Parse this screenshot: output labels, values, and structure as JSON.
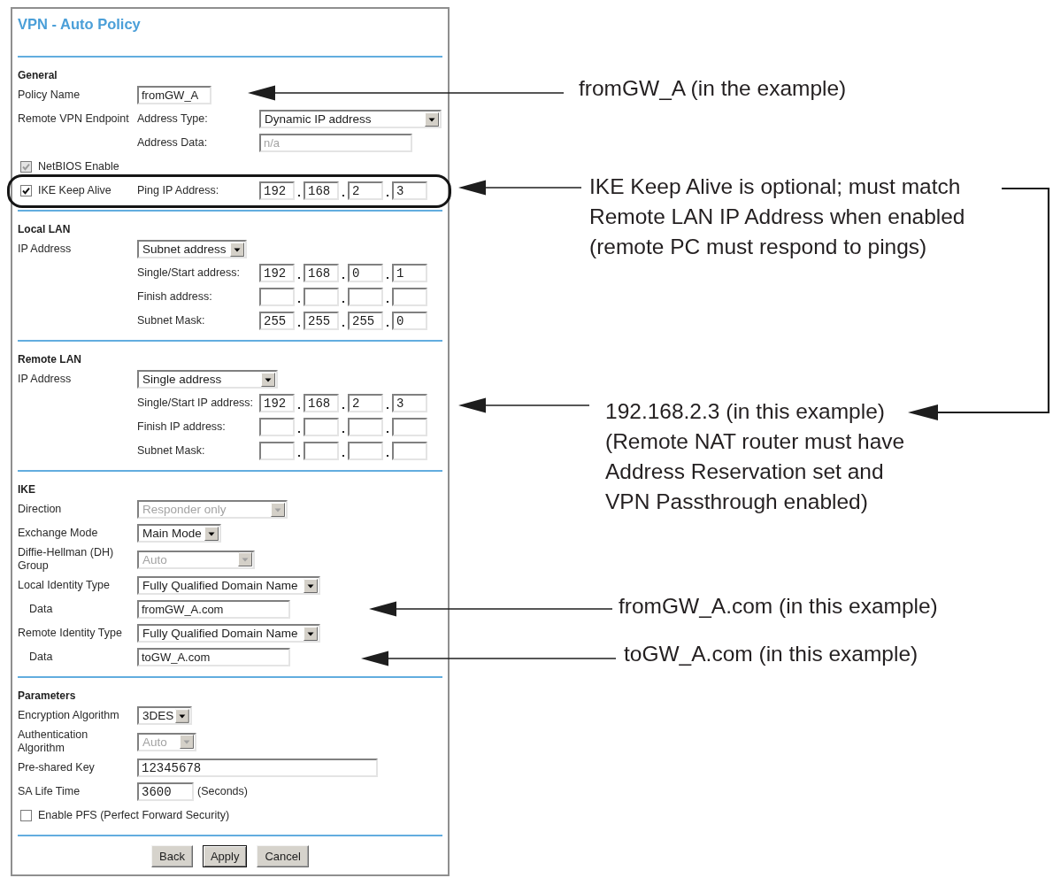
{
  "form": {
    "title": "VPN - Auto Policy",
    "sections": [
      {
        "heading": "General",
        "rows": [
          {
            "kind": "text",
            "label": "Policy Name",
            "value": "fromGW_A",
            "disabled": false
          },
          {
            "kind": "select",
            "label": "Remote VPN Endpoint",
            "sublabel": "Address Type:",
            "value": "Dynamic IP address",
            "disabled": false
          },
          {
            "kind": "text",
            "sublabel": "Address Data:",
            "value": "n/a",
            "disabled": true
          },
          {
            "kind": "check",
            "check": {
              "label": "NetBIOS Enable",
              "checked": true,
              "disabled": true
            }
          },
          {
            "kind": "ip",
            "check": {
              "label": "IKE Keep Alive",
              "checked": true,
              "disabled": false
            },
            "sublabel": "Ping IP Address:",
            "octets": [
              "192",
              "168",
              "2",
              "3"
            ]
          }
        ]
      },
      {
        "heading": "Local LAN",
        "rows": [
          {
            "kind": "select",
            "label": "IP Address",
            "value": "Subnet address",
            "disabled": false
          },
          {
            "kind": "ip",
            "sublabel": "Single/Start address:",
            "octets": [
              "192",
              "168",
              "0",
              "1"
            ]
          },
          {
            "kind": "ip",
            "sublabel": "Finish address:"
          },
          {
            "kind": "ip",
            "sublabel": "Subnet Mask:",
            "octets": [
              "255",
              "255",
              "255",
              "0"
            ]
          }
        ]
      },
      {
        "heading": "Remote LAN",
        "rows": [
          {
            "kind": "select",
            "label": "IP Address",
            "value": "Single address",
            "disabled": false
          },
          {
            "kind": "ip",
            "sublabel": "Single/Start IP address:",
            "octets": [
              "192",
              "168",
              "2",
              "3"
            ]
          },
          {
            "kind": "ip",
            "sublabel": "Finish IP address:"
          },
          {
            "kind": "ip",
            "sublabel": "Subnet Mask:"
          }
        ]
      },
      {
        "heading": "IKE",
        "rows": [
          {
            "kind": "select",
            "label": "Direction",
            "value": "Responder only",
            "disabled": true
          },
          {
            "kind": "select",
            "label": "Exchange Mode",
            "value": "Main Mode",
            "disabled": false
          },
          {
            "kind": "select",
            "label": "Diffie-Hellman (DH) Group",
            "value": "Auto",
            "disabled": true
          },
          {
            "kind": "select",
            "label": "Local Identity Type",
            "value": "Fully Qualified Domain Name",
            "disabled": false
          },
          {
            "kind": "text",
            "label": "Data",
            "value": "fromGW_A.com",
            "disabled": false
          },
          {
            "kind": "select",
            "label": "Remote Identity Type",
            "value": "Fully Qualified Domain Name",
            "disabled": false
          },
          {
            "kind": "text",
            "label": "Data",
            "value": "toGW_A.com",
            "disabled": false
          }
        ]
      },
      {
        "heading": "Parameters",
        "rows": [
          {
            "kind": "select",
            "label": "Encryption Algorithm",
            "value": "3DES",
            "disabled": false
          },
          {
            "kind": "select",
            "label": "Authentication Algorithm",
            "value": "Auto",
            "disabled": true
          },
          {
            "kind": "text",
            "label": "Pre-shared Key",
            "value": "12345678",
            "disabled": false
          },
          {
            "kind": "text",
            "label": "SA Life Time",
            "value": "3600",
            "unit": "(Seconds)",
            "disabled": false
          },
          {
            "kind": "check",
            "check": {
              "label": "Enable PFS (Perfect Forward Security)",
              "checked": false,
              "disabled": false
            }
          }
        ]
      }
    ],
    "buttons": [
      {
        "label": "Back",
        "default": false
      },
      {
        "label": "Apply",
        "default": true
      },
      {
        "label": "Cancel",
        "default": false
      }
    ]
  },
  "callouts": [
    {
      "lines": [
        "fromGW_A (in the example)"
      ]
    },
    {
      "lines": [
        "IKE Keep Alive is optional; must match",
        "Remote LAN IP Address when enabled",
        "(remote PC must respond to pings)"
      ]
    },
    {
      "lines": [
        "192.168.2.3 (in this example)",
        "(Remote NAT router must have",
        "Address Reservation set and",
        "VPN Passthrough enabled)"
      ]
    },
    {
      "lines": [
        "fromGW_A.com (in this example)"
      ]
    },
    {
      "lines": [
        "toGW_A.com (in this example)"
      ]
    }
  ]
}
